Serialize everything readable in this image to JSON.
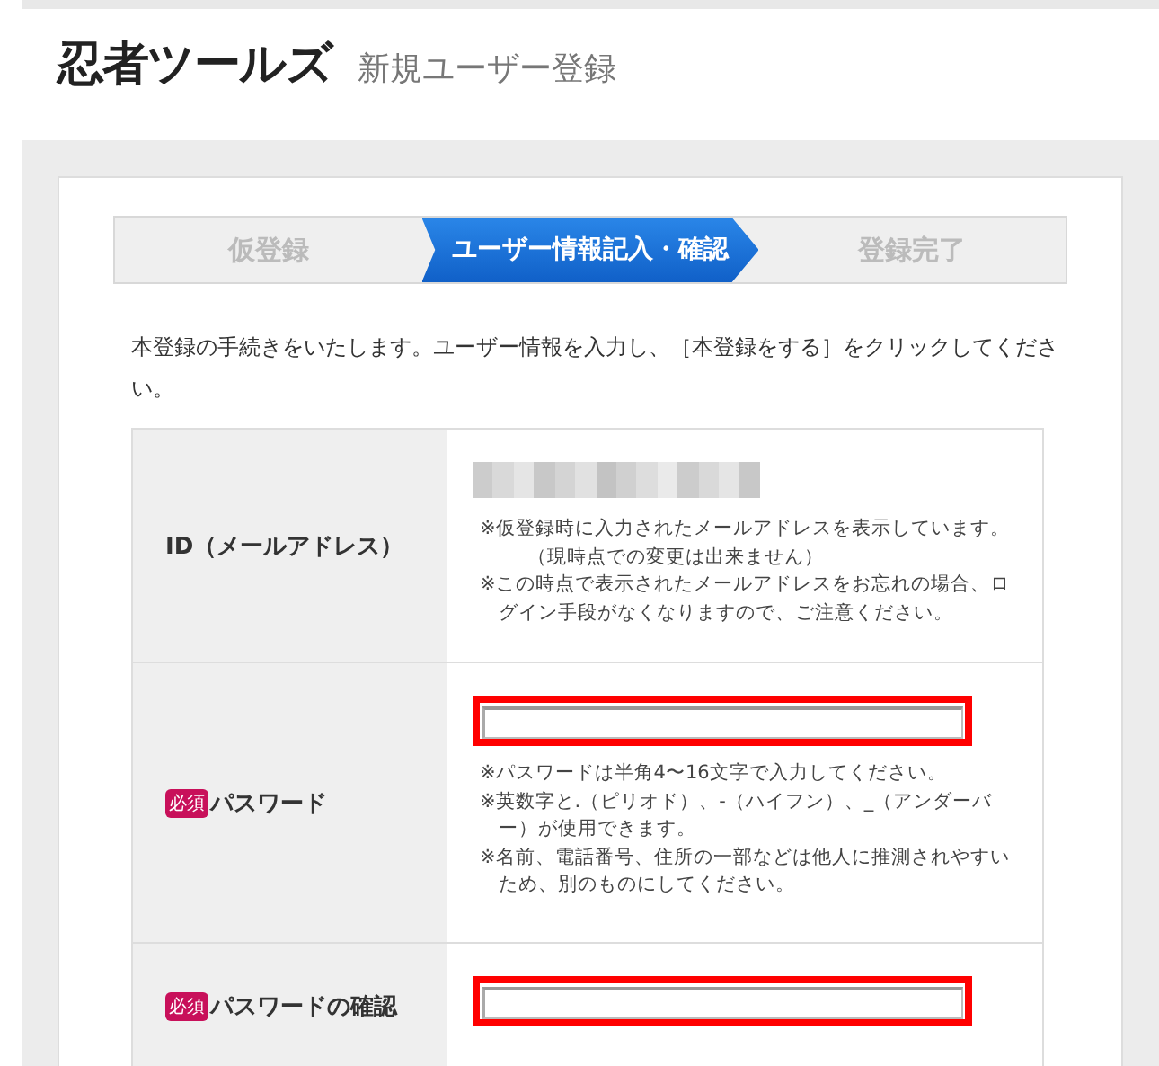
{
  "header": {
    "logo": "忍者ツールズ",
    "subtitle": "新規ユーザー登録"
  },
  "steps": [
    {
      "label": "仮登録",
      "selected": false
    },
    {
      "label": "ユーザー情報記入・確認",
      "selected": true
    },
    {
      "label": "登録完了",
      "selected": false
    }
  ],
  "intro": "本登録の手続きをいたします。ユーザー情報を入力し、［本登録をする］をクリックしてください。",
  "rows": [
    {
      "kind": "display",
      "label": "ID（メールアドレス）",
      "notes": [
        {
          "kind": "main",
          "text": "※仮登録時に入力されたメールアドレスを表示しています。"
        },
        {
          "kind": "sub",
          "text": "（現時点での変更は出来ません）"
        },
        {
          "kind": "main",
          "text": "※この時点で表示されたメールアドレスをお忘れの場合、ログイン手段がなくなりますので、ご注意ください。"
        }
      ]
    },
    {
      "kind": "input",
      "badge": "必須",
      "label": "パスワード",
      "notes": [
        {
          "kind": "main",
          "text": "※パスワードは半角4〜16文字で入力してください。"
        },
        {
          "kind": "main",
          "text": "※英数字と.（ピリオド）、-（ハイフン）、_（アンダーバー）が使用できます。"
        },
        {
          "kind": "main",
          "text": "※名前、電話番号、住所の一部などは他人に推測されやすいため、別のものにしてください。"
        }
      ]
    },
    {
      "kind": "input",
      "badge": "必須",
      "label": "パスワードの確認",
      "notes": []
    }
  ]
}
